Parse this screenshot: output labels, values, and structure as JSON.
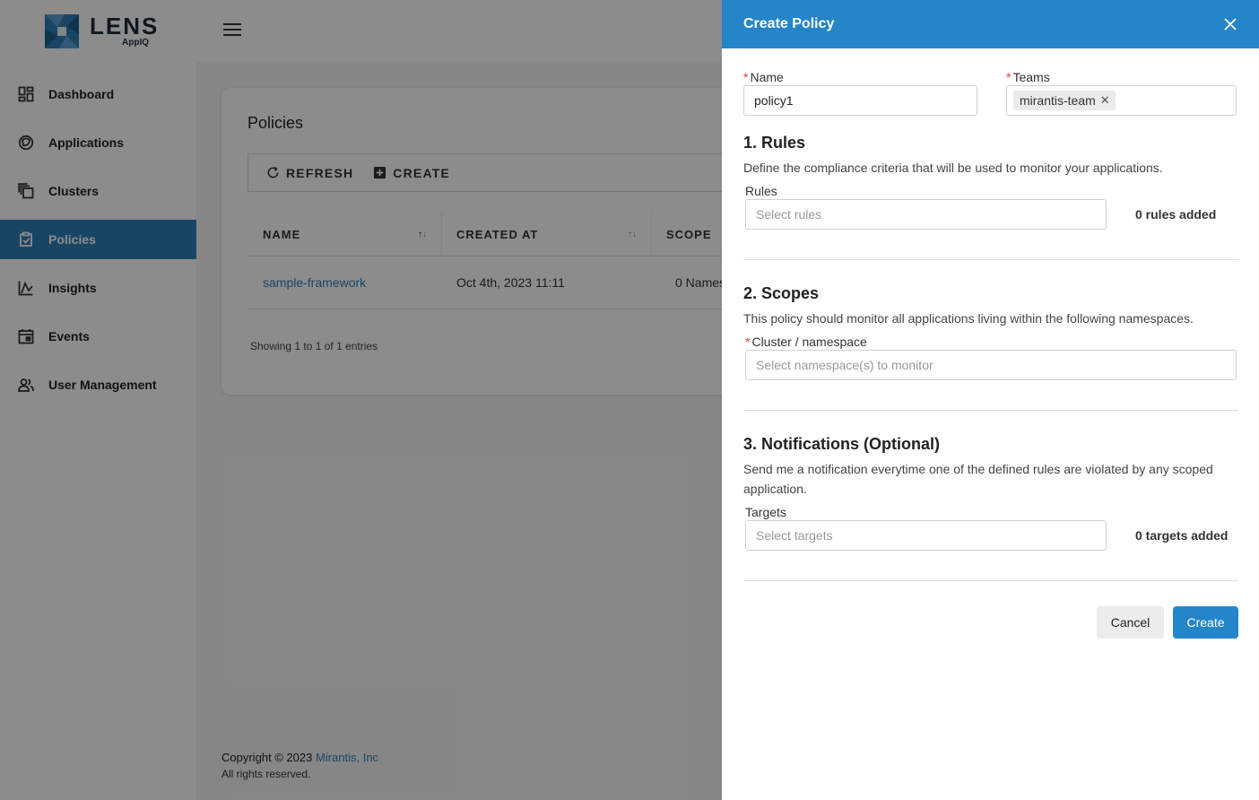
{
  "colors": {
    "accent": "#2585c9",
    "sidebar_active": "#2f7fb8",
    "required": "#e53935",
    "link": "#2f7fb8"
  },
  "brand": {
    "name": "LENS",
    "sub": "AppIQ"
  },
  "sidebar": {
    "items": [
      {
        "label": "Dashboard",
        "icon": "dashboard-icon"
      },
      {
        "label": "Applications",
        "icon": "applications-icon"
      },
      {
        "label": "Clusters",
        "icon": "clusters-icon"
      },
      {
        "label": "Policies",
        "icon": "policies-icon",
        "active": true
      },
      {
        "label": "Insights",
        "icon": "insights-icon"
      },
      {
        "label": "Events",
        "icon": "events-icon"
      },
      {
        "label": "User Management",
        "icon": "users-icon"
      }
    ]
  },
  "policies_page": {
    "title": "Policies",
    "toolbar": {
      "refresh": "REFRESH",
      "create": "CREATE"
    },
    "columns": [
      "NAME",
      "CREATED AT",
      "SCOPE"
    ],
    "rows": [
      {
        "name": "sample-framework",
        "created_at": "Oct 4th, 2023 11:11",
        "scope": "0 Names"
      }
    ],
    "entries": "Showing 1 to 1 of 1 entries"
  },
  "footer": {
    "copyright": "Copyright © 2023",
    "company": "Mirantis, Inc",
    "rights": "All rights reserved."
  },
  "drawer": {
    "title": "Create Policy",
    "name": {
      "label": "Name",
      "value": "policy1"
    },
    "teams": {
      "label": "Teams",
      "tags": [
        "mirantis-team"
      ]
    },
    "rules": {
      "title": "1. Rules",
      "description": "Define the compliance criteria that will be used to monitor your applications.",
      "field_label": "Rules",
      "placeholder": "Select rules",
      "count": "0 rules added"
    },
    "scopes": {
      "title": "2. Scopes",
      "description": "This policy should monitor all applications living within the following namespaces.",
      "field_label": "Cluster / namespace",
      "placeholder": "Select namespace(s) to monitor"
    },
    "notifications": {
      "title": "3. Notifications (Optional)",
      "description": "Send me a notification everytime one of the defined rules are violated by any scoped application.",
      "field_label": "Targets",
      "placeholder": "Select targets",
      "count": "0 targets added"
    },
    "buttons": {
      "cancel": "Cancel",
      "create": "Create"
    }
  }
}
